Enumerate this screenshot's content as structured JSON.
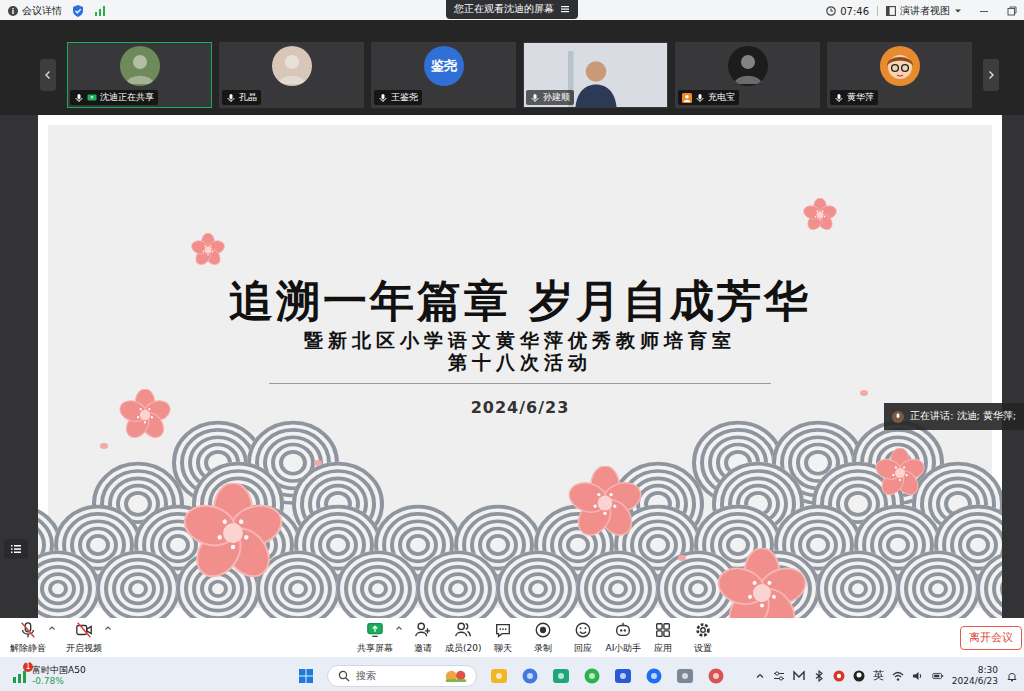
{
  "topbar": {
    "meeting_info": "会议详情",
    "banner": "您正在观看沈迪的屏幕",
    "time": "07:46",
    "view": "演讲者视图"
  },
  "participants": [
    {
      "label": "沈迪正在共享",
      "avatar": "photo",
      "avatar_text": "",
      "color": "#6f8a5a",
      "selected": true,
      "sharing": true,
      "host": false
    },
    {
      "label": "孔晶",
      "avatar": "photo",
      "avatar_text": "",
      "color": "#d8c7b8",
      "selected": false,
      "sharing": false,
      "host": false
    },
    {
      "label": "王鉴尧",
      "avatar": "text",
      "avatar_text": "鉴尧",
      "color": "#2f6fd6",
      "selected": false,
      "sharing": false,
      "host": false
    },
    {
      "label": "孙建顺",
      "avatar": "video",
      "avatar_text": "",
      "color": "#d9dde3",
      "selected": false,
      "sharing": false,
      "host": false
    },
    {
      "label": "充电宝",
      "avatar": "photo",
      "avatar_text": "",
      "color": "#1c1c1c",
      "selected": false,
      "sharing": false,
      "host": true
    },
    {
      "label": "黄华萍",
      "avatar": "cartoon",
      "avatar_text": "",
      "color": "#e88a2e",
      "selected": false,
      "sharing": false,
      "host": false
    }
  ],
  "slide": {
    "title": "追溯一年篇章 岁月自成芳华",
    "subtitle": [
      "暨新北区小学语文黄华萍优秀教师培育室",
      "第十八次活动"
    ],
    "date": "2024/6/23"
  },
  "speaking": "正在讲话: 沈迪; 黄华萍;",
  "toolbar": {
    "left": [
      {
        "label": "解除静音",
        "kind": "mic",
        "off": true
      },
      {
        "label": "开启视频",
        "kind": "camera",
        "off": true
      }
    ],
    "center": [
      {
        "label": "共享屏幕",
        "kind": "share",
        "on": true
      },
      {
        "label": "邀请",
        "kind": "invite",
        "on": false
      },
      {
        "label": "成员(20)",
        "kind": "members",
        "on": false
      },
      {
        "label": "聊天",
        "kind": "chat",
        "on": false
      },
      {
        "label": "录制",
        "kind": "record",
        "on": false
      },
      {
        "label": "回应",
        "kind": "react",
        "on": false
      },
      {
        "label": "AI小助手",
        "kind": "ai",
        "on": false
      },
      {
        "label": "应用",
        "kind": "apps",
        "on": false
      },
      {
        "label": "设置",
        "kind": "settings",
        "on": false
      }
    ],
    "leave": "离开会议"
  },
  "taskbar": {
    "stock": {
      "name": "富时中国A50",
      "change": "-0.78%",
      "badge": "1"
    },
    "search": "搜索",
    "ime": "英",
    "time": "8:30",
    "date": "2024/6/23"
  }
}
